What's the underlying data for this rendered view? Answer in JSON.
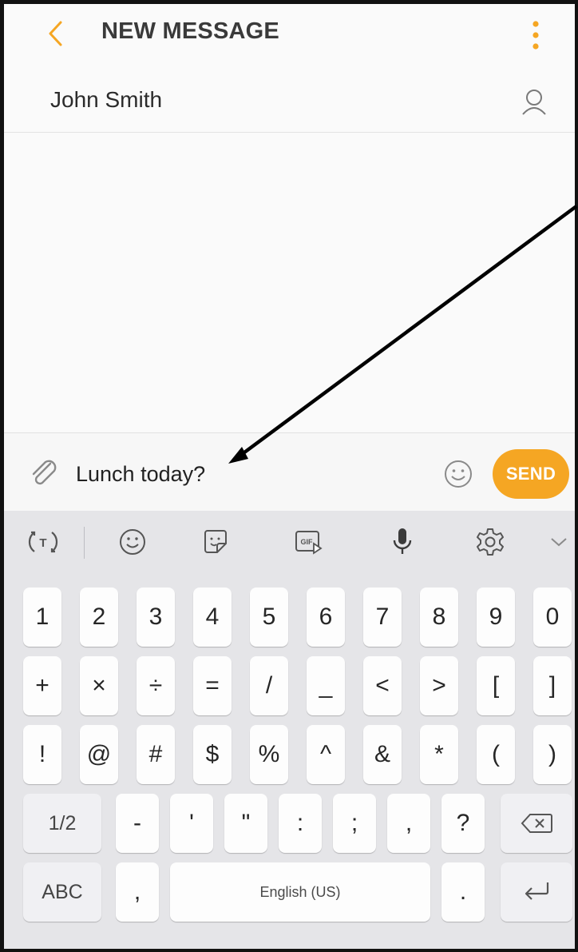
{
  "header": {
    "title": "NEW MESSAGE",
    "back_icon": "chevron-left-icon",
    "more_icon": "more-vertical-icon"
  },
  "recipient": {
    "name": "John Smith",
    "contact_icon": "person-icon"
  },
  "compose": {
    "attach_icon": "paperclip-icon",
    "message_text": "Lunch today?",
    "emoji_icon": "smiley-icon",
    "send_label": "SEND"
  },
  "keyboard": {
    "toolbar": {
      "icons": [
        "text-mode-icon",
        "emoji-icon",
        "sticker-icon",
        "gif-icon",
        "microphone-icon",
        "settings-icon",
        "chevron-down-icon"
      ],
      "gif_label": "GIF"
    },
    "rows": [
      [
        "1",
        "2",
        "3",
        "4",
        "5",
        "6",
        "7",
        "8",
        "9",
        "0"
      ],
      [
        "+",
        "×",
        "÷",
        "=",
        "/",
        "_",
        "<",
        ">",
        "[",
        "]"
      ],
      [
        "!",
        "@",
        "#",
        "$",
        "%",
        "^",
        "&",
        "*",
        "(",
        ")"
      ],
      [
        "-",
        "'",
        "\"",
        ":",
        ";",
        ",",
        "?"
      ]
    ],
    "shift_label": "1/2",
    "backspace_icon": "backspace-icon",
    "abc_label": "ABC",
    "comma_label": ",",
    "space_label": "English (US)",
    "period_label": ".",
    "enter_icon": "enter-icon"
  },
  "colors": {
    "accent": "#f5a623",
    "keyboard_bg": "#e5e5e8",
    "key_bg": "#fdfdfd"
  }
}
